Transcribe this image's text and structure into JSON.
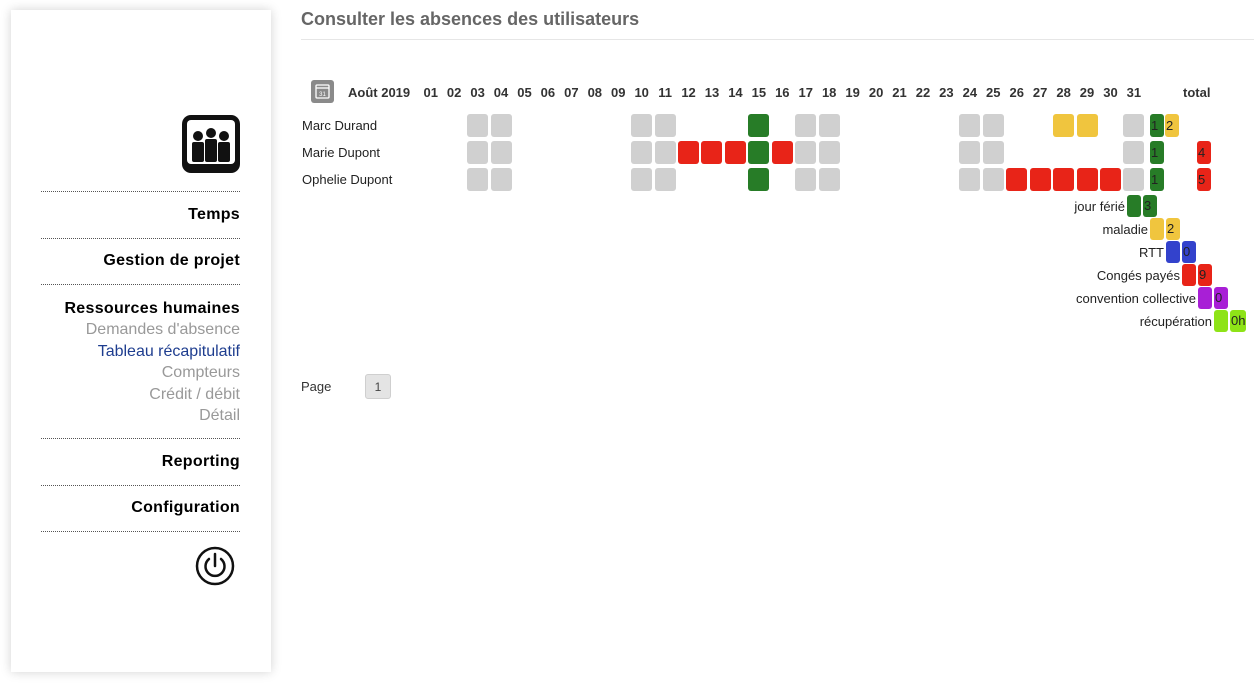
{
  "sidebar": {
    "menu": [
      {
        "title": "Temps"
      },
      {
        "title": "Gestion de projet"
      },
      {
        "title": "Ressources humaines",
        "items": [
          {
            "label": "Demandes d'absence",
            "active": false
          },
          {
            "label": "Tableau récapitulatif",
            "active": true
          },
          {
            "label": "Compteurs",
            "active": false
          },
          {
            "label": "Crédit / débit",
            "active": false
          },
          {
            "label": "Détail",
            "active": false
          }
        ]
      },
      {
        "title": "Reporting"
      },
      {
        "title": "Configuration"
      }
    ],
    "logo_icon": "people-group-icon",
    "logout_icon": "power-icon"
  },
  "main": {
    "title": "Consulter les absences des utilisateurs",
    "calendar": {
      "icon": "calendar-icon",
      "calendar_icon_text": "31",
      "month_label": "Août 2019",
      "days": [
        "01",
        "02",
        "03",
        "04",
        "05",
        "06",
        "07",
        "08",
        "09",
        "10",
        "11",
        "12",
        "13",
        "14",
        "15",
        "16",
        "17",
        "18",
        "19",
        "20",
        "21",
        "22",
        "23",
        "24",
        "25",
        "26",
        "27",
        "28",
        "29",
        "30",
        "31"
      ],
      "total_label": "total",
      "colors": {
        "weekend": "#d0d0d0",
        "jour_ferie": "#277c27",
        "maladie": "#f0c53e",
        "rtt": "#3342cc",
        "conges_payes": "#e82418",
        "convention_collective": "#a81fd6",
        "recuperation": "#8ee317"
      },
      "users": [
        {
          "name": "Marc Durand",
          "days": [
            "",
            "",
            "weekend",
            "weekend",
            "",
            "",
            "",
            "",
            "",
            "weekend",
            "weekend",
            "",
            "",
            "",
            "jour_ferie",
            "",
            "weekend",
            "weekend",
            "",
            "",
            "",
            "",
            "",
            "weekend",
            "weekend",
            "",
            "",
            "maladie",
            "maladie",
            "",
            "weekend"
          ],
          "totals": [
            {
              "type": "jour_ferie",
              "value": "1"
            },
            {
              "type": "maladie",
              "value": "2"
            }
          ]
        },
        {
          "name": "Marie Dupont",
          "days": [
            "",
            "",
            "weekend",
            "weekend",
            "",
            "",
            "",
            "",
            "",
            "weekend",
            "weekend",
            "conges_payes",
            "conges_payes",
            "conges_payes",
            "jour_ferie",
            "conges_payes",
            "weekend",
            "weekend",
            "",
            "",
            "",
            "",
            "",
            "weekend",
            "weekend",
            "",
            "",
            "",
            "",
            "",
            "weekend"
          ],
          "totals": [
            {
              "type": "jour_ferie",
              "value": "1"
            },
            {
              "type": "conges_payes",
              "value": "4"
            }
          ]
        },
        {
          "name": "Ophelie Dupont",
          "days": [
            "",
            "",
            "weekend",
            "weekend",
            "",
            "",
            "",
            "",
            "",
            "weekend",
            "weekend",
            "",
            "",
            "",
            "jour_ferie",
            "",
            "weekend",
            "weekend",
            "",
            "",
            "",
            "",
            "",
            "weekend",
            "weekend",
            "conges_payes",
            "conges_payes",
            "conges_payes",
            "conges_payes",
            "conges_payes",
            "weekend"
          ],
          "totals": [
            {
              "type": "jour_ferie",
              "value": "1"
            },
            {
              "type": "conges_payes",
              "value": "5"
            }
          ]
        }
      ],
      "legend": [
        {
          "label": "jour férié",
          "type": "jour_ferie",
          "value": "3"
        },
        {
          "label": "maladie",
          "type": "maladie",
          "value": "2"
        },
        {
          "label": "RTT",
          "type": "rtt",
          "value": "0"
        },
        {
          "label": "Congés payés",
          "type": "conges_payes",
          "value": "9"
        },
        {
          "label": "convention collective",
          "type": "convention_collective",
          "value": "0"
        },
        {
          "label": "récupération",
          "type": "recuperation",
          "value": "0h"
        }
      ]
    },
    "pagination": {
      "label": "Page",
      "pages": [
        "1"
      ]
    }
  }
}
